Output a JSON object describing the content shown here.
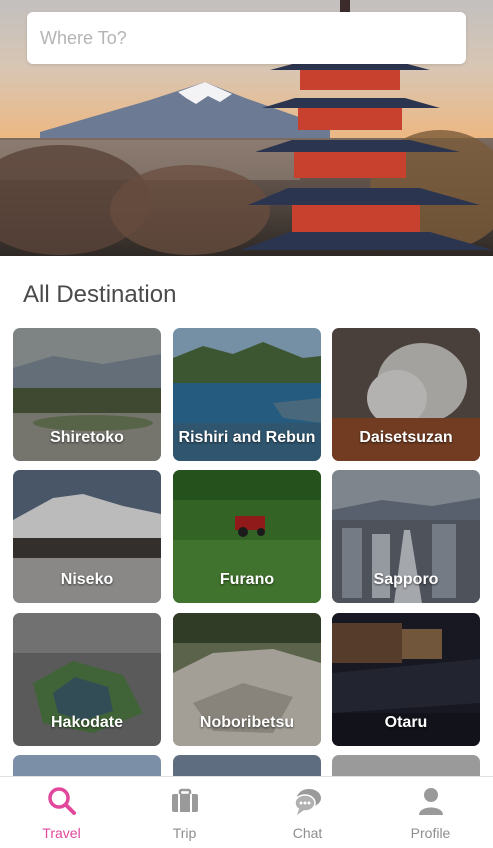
{
  "search": {
    "placeholder": "Where To?"
  },
  "section": {
    "title": "All Destination"
  },
  "destinations": [
    {
      "name": "Shiretoko"
    },
    {
      "name": "Rishiri and Rebun"
    },
    {
      "name": "Daisetsuzan"
    },
    {
      "name": "Niseko"
    },
    {
      "name": "Furano"
    },
    {
      "name": "Sapporo"
    },
    {
      "name": "Hakodate"
    },
    {
      "name": "Noboribetsu"
    },
    {
      "name": "Otaru"
    }
  ],
  "tabs": [
    {
      "label": "Travel",
      "icon": "search-icon",
      "active": true
    },
    {
      "label": "Trip",
      "icon": "suitcase-icon",
      "active": false
    },
    {
      "label": "Chat",
      "icon": "chat-icon",
      "active": false
    },
    {
      "label": "Profile",
      "icon": "person-icon",
      "active": false
    }
  ],
  "colors": {
    "accent": "#e1479a",
    "inactive": "#8e8e8e",
    "title": "#4a4a4a"
  }
}
